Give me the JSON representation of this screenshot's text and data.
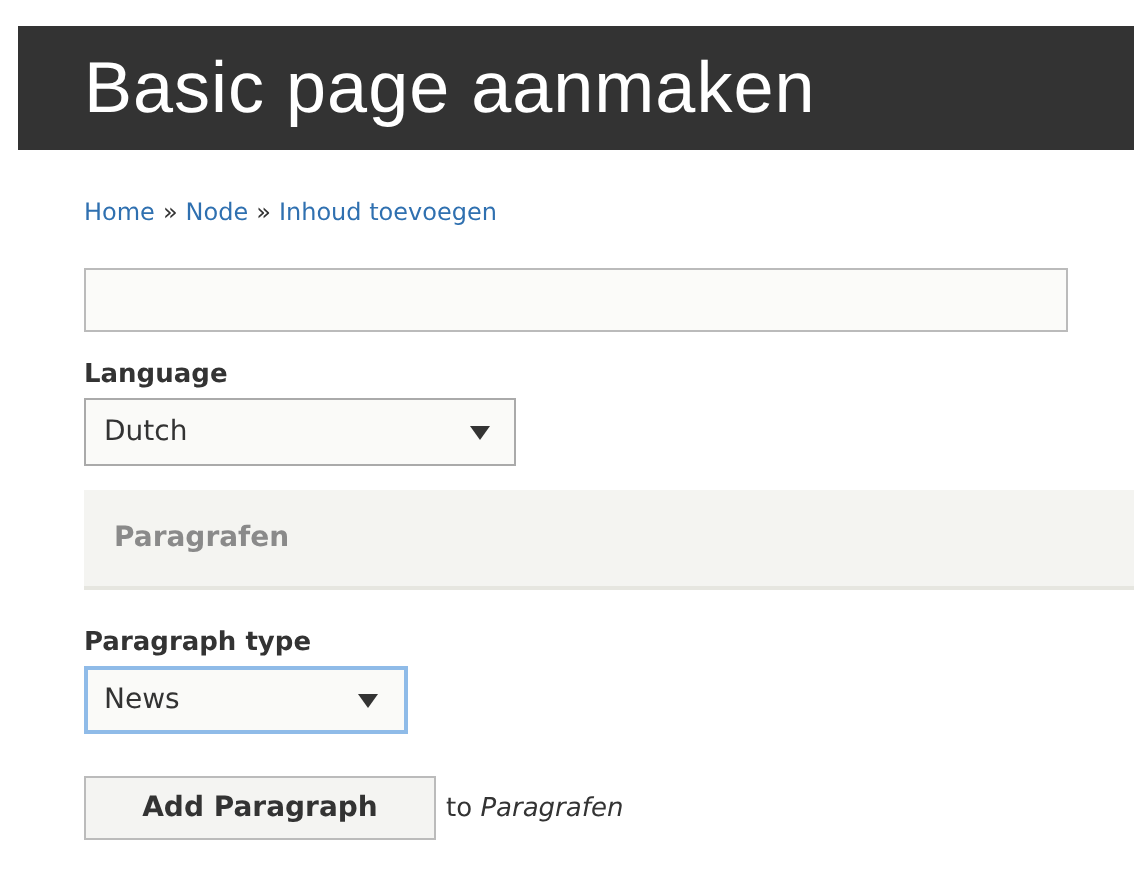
{
  "page_title": "Basic page aanmaken",
  "breadcrumb": [
    {
      "kind": "link",
      "text": "Home"
    },
    {
      "kind": "sep",
      "text": "»"
    },
    {
      "kind": "link",
      "text": "Node"
    },
    {
      "kind": "sep",
      "text": "»"
    },
    {
      "kind": "link",
      "text": "Inhoud toevoegen"
    }
  ],
  "form": [
    {
      "kind": "text"
    },
    {
      "kind": "select",
      "label": "Language",
      "value": "Dutch",
      "focused": false
    },
    {
      "kind": "panel",
      "title": "Paragrafen"
    },
    {
      "kind": "select",
      "label": "Paragraph type",
      "value": "News",
      "focused": true
    },
    {
      "kind": "add",
      "button": "Add Paragraph",
      "text": "to *Paragrafen*"
    }
  ]
}
